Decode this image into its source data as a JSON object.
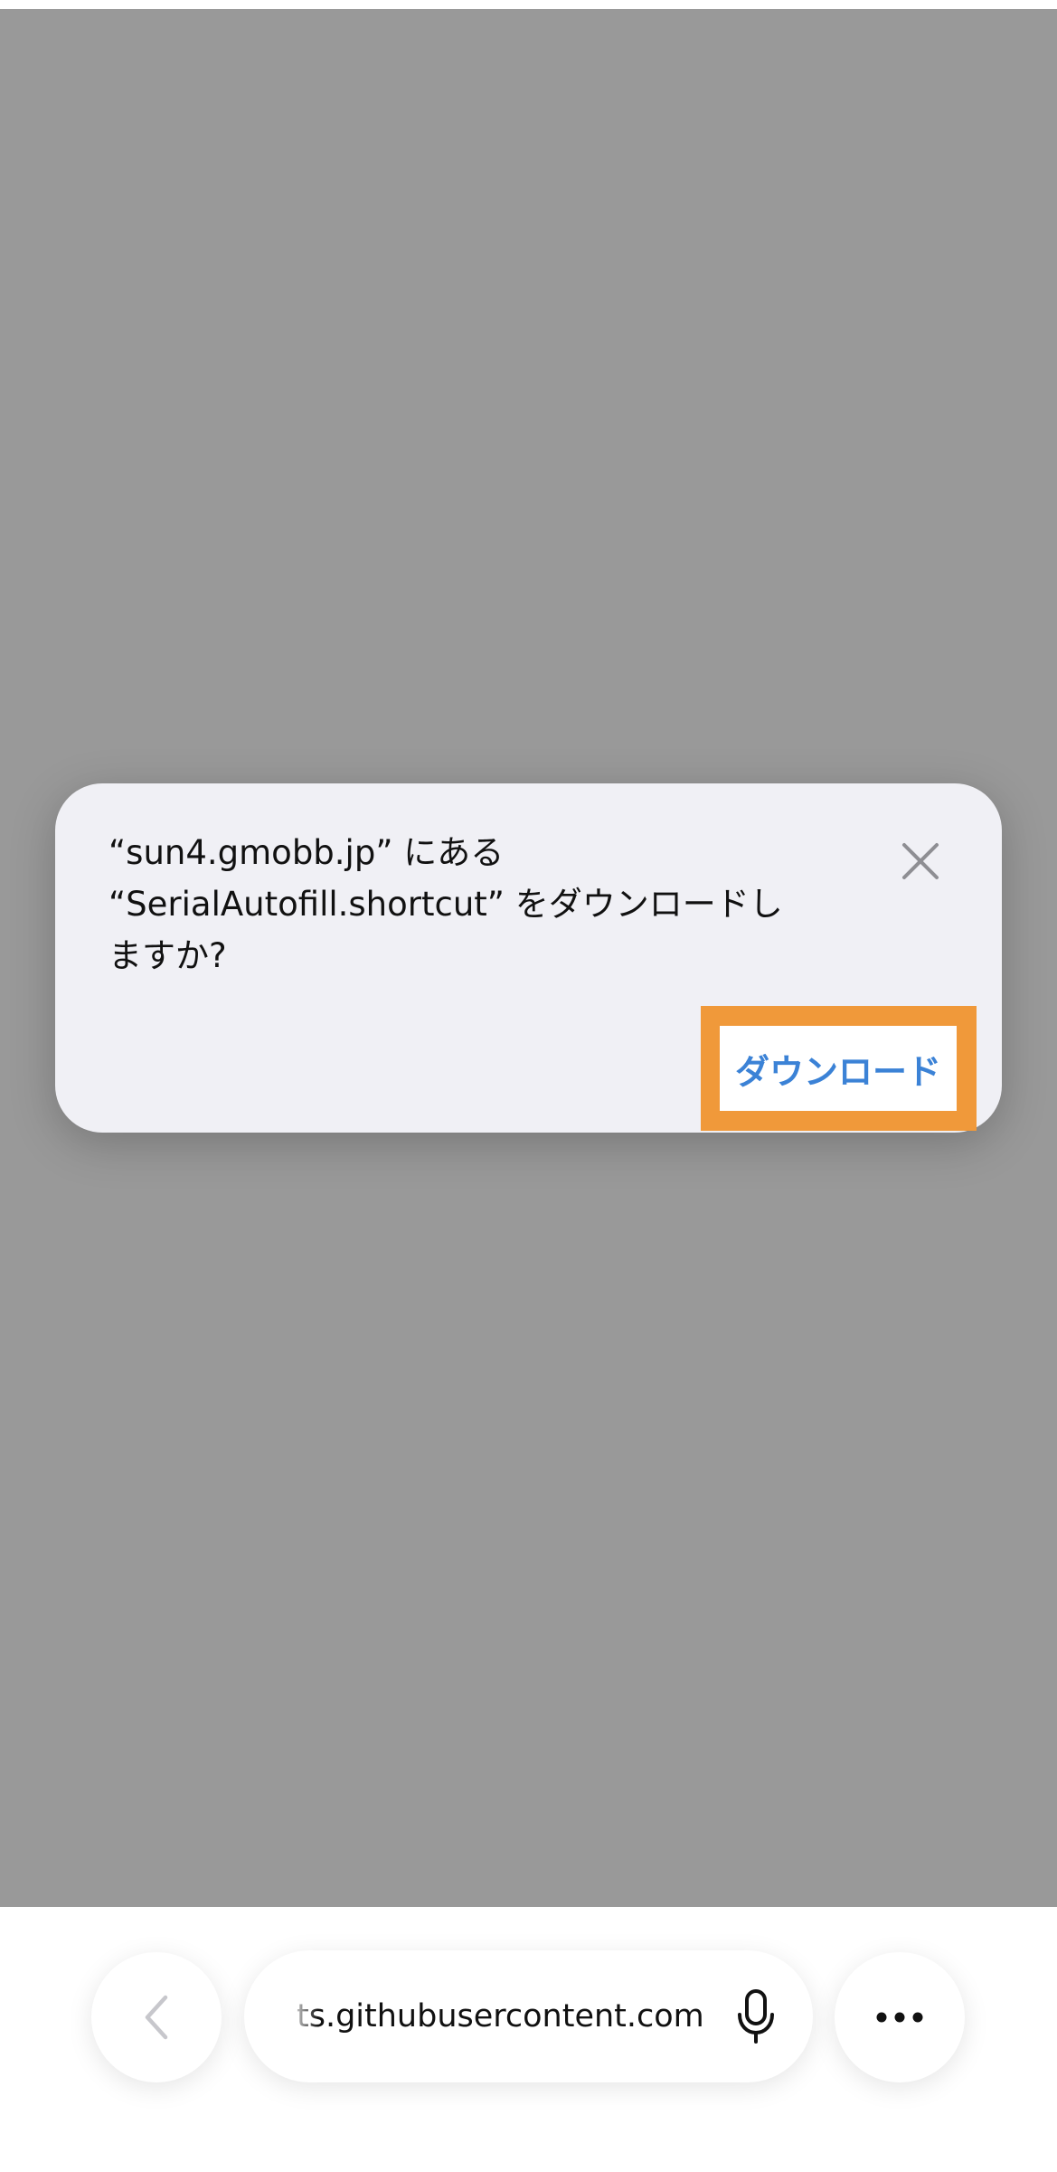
{
  "dialog": {
    "message_lines": [
      "“sun4.gmobb.jp” にある",
      "“SerialAutofill.shortcut” をダウンロードし",
      "ますか?"
    ],
    "download_label": "ダウンロード",
    "close_icon": "close-icon",
    "highlight_color": "#f0993a",
    "button_text_color": "#3b82d6"
  },
  "toolbar": {
    "back_icon": "chevron-left-icon",
    "url": "ts.githubusercontent.com",
    "mic_icon": "microphone-icon",
    "more_icon": "ellipsis-icon"
  },
  "colors": {
    "backdrop": "#999999",
    "dialog_background": "#f0f0f5"
  }
}
